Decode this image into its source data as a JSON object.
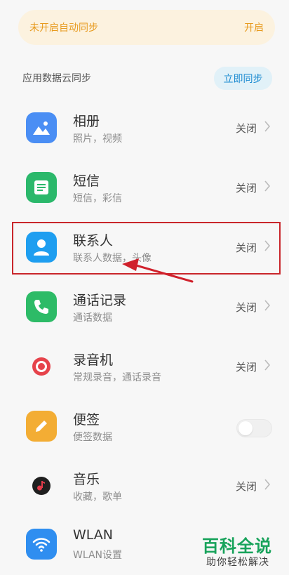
{
  "banner": {
    "text": "未开启自动同步",
    "action": "开启"
  },
  "section": {
    "title": "应用数据云同步",
    "sync_now": "立即同步"
  },
  "items": [
    {
      "title": "相册",
      "subtitle": "照片，视频",
      "status": "关闭",
      "icon": "gallery-icon",
      "color": "#4a8ef4"
    },
    {
      "title": "短信",
      "subtitle": "短信，彩信",
      "status": "关闭",
      "icon": "message-icon",
      "color": "#2bb86b"
    },
    {
      "title": "联系人",
      "subtitle": "联系人数据，头像",
      "status": "关闭",
      "icon": "contacts-icon",
      "color": "#1e9ef0"
    },
    {
      "title": "通话记录",
      "subtitle": "通话数据",
      "status": "关闭",
      "icon": "phone-icon",
      "color": "#2dbb67"
    },
    {
      "title": "录音机",
      "subtitle": "常规录音，通话录音",
      "status": "关闭",
      "icon": "recorder-icon",
      "color": "#e6434b"
    },
    {
      "title": "便签",
      "subtitle": "便签数据",
      "status": "",
      "icon": "notes-icon",
      "color": "#f3ad34"
    },
    {
      "title": "音乐",
      "subtitle": "收藏，歌单",
      "status": "关闭",
      "icon": "music-icon",
      "color": "#e13b4a"
    },
    {
      "title": "WLAN",
      "subtitle": "WLAN设置",
      "status": "",
      "icon": "wifi-icon",
      "color": "#2f8ef0"
    }
  ],
  "notes_toggle": {
    "on": false
  },
  "watermark": {
    "title": "百科全说",
    "subtitle": "助你轻松解决"
  }
}
